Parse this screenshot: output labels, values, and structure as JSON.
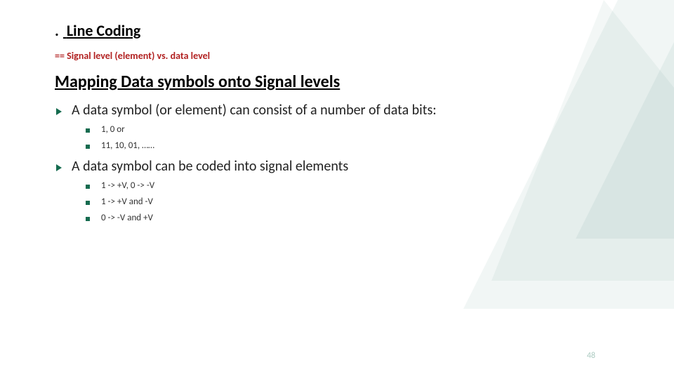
{
  "title": "Line Coding",
  "title_lead": ".",
  "subline_prefix": "==",
  "subline": "Signal level (element) vs. data level",
  "section": "Mapping Data symbols onto Signal levels",
  "bullets": [
    {
      "text": "A data symbol (or element) can consist of a number of data bits:",
      "sub": [
        "1, 0 or",
        "11, 10, 01, ……"
      ]
    },
    {
      "text": "A data symbol can be coded into signal elements",
      "sub": [
        "1 -> +V, 0 -> -V",
        "1 -> +V and -V",
        "0 -> -V and +V"
      ]
    }
  ],
  "page_number": "48",
  "colors": {
    "accent": "#156b4f",
    "subline": "#b22222"
  }
}
